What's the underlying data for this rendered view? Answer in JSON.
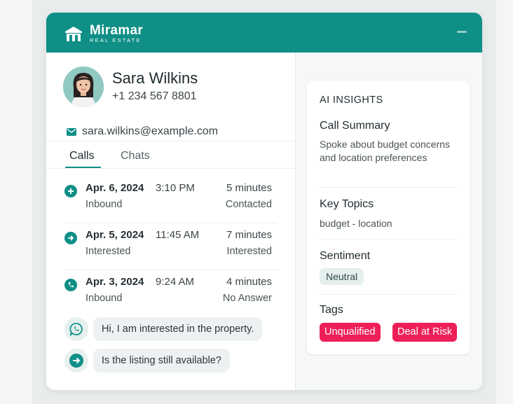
{
  "brand": {
    "name": "Miramar",
    "subtitle": "REAL ESTATE"
  },
  "contact": {
    "name": "Sara Wilkins",
    "phone": "+1 234 567 8801",
    "email": "sara.wilkins@example.com"
  },
  "tabs": [
    {
      "label": "Calls",
      "active": true
    },
    {
      "label": "Chats",
      "active": false
    }
  ],
  "calls": [
    {
      "icon": "plus-icon",
      "date": "Apr. 6, 2024",
      "time": "3:10 PM",
      "duration": "5 minutes",
      "type": "Inbound",
      "status": "Contacted"
    },
    {
      "icon": "arrow-right-icon",
      "date": "Apr. 5, 2024",
      "time": "11:45 AM",
      "duration": "7 minutes",
      "type": "Interested",
      "status": "Interested"
    },
    {
      "icon": "phone-icon",
      "date": "Apr. 3, 2024",
      "time": "9:24 AM",
      "duration": "4 minutes",
      "type": "Inbound",
      "status": "No Answer"
    }
  ],
  "chats": [
    {
      "icon": "whatsapp-icon",
      "text": "Hi, I am interested in the property."
    },
    {
      "icon": "arrow-right-icon",
      "text": "Is the listing still available?"
    }
  ],
  "insights": {
    "title": "AI INSIGHTS",
    "call_summary_title": "Call Summary",
    "call_summary": "Spoke about budget concerns and location preferences",
    "key_topics_title": "Key Topics",
    "key_topics": "budget - location",
    "sentiment_title": "Sentiment",
    "sentiment": "Neutral",
    "tags_title": "Tags",
    "tags": [
      "Unqualified",
      "Deal at Risk"
    ]
  },
  "colors": {
    "accent": "#0f8f86",
    "tag": "#ee1f57",
    "neutral_pill": "#e5efee"
  }
}
